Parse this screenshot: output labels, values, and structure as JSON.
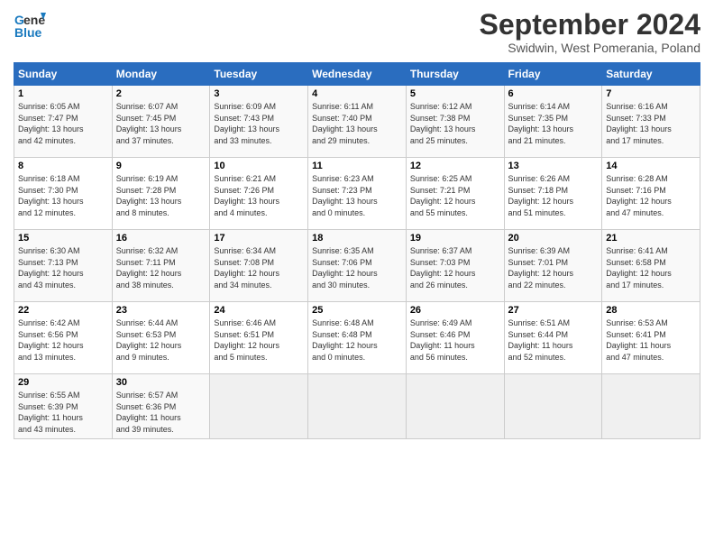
{
  "header": {
    "logo_line1": "General",
    "logo_line2": "Blue",
    "month_title": "September 2024",
    "subtitle": "Swidwin, West Pomerania, Poland"
  },
  "weekdays": [
    "Sunday",
    "Monday",
    "Tuesday",
    "Wednesday",
    "Thursday",
    "Friday",
    "Saturday"
  ],
  "weeks": [
    [
      {
        "day": "1",
        "detail": "Sunrise: 6:05 AM\nSunset: 7:47 PM\nDaylight: 13 hours\nand 42 minutes."
      },
      {
        "day": "2",
        "detail": "Sunrise: 6:07 AM\nSunset: 7:45 PM\nDaylight: 13 hours\nand 37 minutes."
      },
      {
        "day": "3",
        "detail": "Sunrise: 6:09 AM\nSunset: 7:43 PM\nDaylight: 13 hours\nand 33 minutes."
      },
      {
        "day": "4",
        "detail": "Sunrise: 6:11 AM\nSunset: 7:40 PM\nDaylight: 13 hours\nand 29 minutes."
      },
      {
        "day": "5",
        "detail": "Sunrise: 6:12 AM\nSunset: 7:38 PM\nDaylight: 13 hours\nand 25 minutes."
      },
      {
        "day": "6",
        "detail": "Sunrise: 6:14 AM\nSunset: 7:35 PM\nDaylight: 13 hours\nand 21 minutes."
      },
      {
        "day": "7",
        "detail": "Sunrise: 6:16 AM\nSunset: 7:33 PM\nDaylight: 13 hours\nand 17 minutes."
      }
    ],
    [
      {
        "day": "8",
        "detail": "Sunrise: 6:18 AM\nSunset: 7:30 PM\nDaylight: 13 hours\nand 12 minutes."
      },
      {
        "day": "9",
        "detail": "Sunrise: 6:19 AM\nSunset: 7:28 PM\nDaylight: 13 hours\nand 8 minutes."
      },
      {
        "day": "10",
        "detail": "Sunrise: 6:21 AM\nSunset: 7:26 PM\nDaylight: 13 hours\nand 4 minutes."
      },
      {
        "day": "11",
        "detail": "Sunrise: 6:23 AM\nSunset: 7:23 PM\nDaylight: 13 hours\nand 0 minutes."
      },
      {
        "day": "12",
        "detail": "Sunrise: 6:25 AM\nSunset: 7:21 PM\nDaylight: 12 hours\nand 55 minutes."
      },
      {
        "day": "13",
        "detail": "Sunrise: 6:26 AM\nSunset: 7:18 PM\nDaylight: 12 hours\nand 51 minutes."
      },
      {
        "day": "14",
        "detail": "Sunrise: 6:28 AM\nSunset: 7:16 PM\nDaylight: 12 hours\nand 47 minutes."
      }
    ],
    [
      {
        "day": "15",
        "detail": "Sunrise: 6:30 AM\nSunset: 7:13 PM\nDaylight: 12 hours\nand 43 minutes."
      },
      {
        "day": "16",
        "detail": "Sunrise: 6:32 AM\nSunset: 7:11 PM\nDaylight: 12 hours\nand 38 minutes."
      },
      {
        "day": "17",
        "detail": "Sunrise: 6:34 AM\nSunset: 7:08 PM\nDaylight: 12 hours\nand 34 minutes."
      },
      {
        "day": "18",
        "detail": "Sunrise: 6:35 AM\nSunset: 7:06 PM\nDaylight: 12 hours\nand 30 minutes."
      },
      {
        "day": "19",
        "detail": "Sunrise: 6:37 AM\nSunset: 7:03 PM\nDaylight: 12 hours\nand 26 minutes."
      },
      {
        "day": "20",
        "detail": "Sunrise: 6:39 AM\nSunset: 7:01 PM\nDaylight: 12 hours\nand 22 minutes."
      },
      {
        "day": "21",
        "detail": "Sunrise: 6:41 AM\nSunset: 6:58 PM\nDaylight: 12 hours\nand 17 minutes."
      }
    ],
    [
      {
        "day": "22",
        "detail": "Sunrise: 6:42 AM\nSunset: 6:56 PM\nDaylight: 12 hours\nand 13 minutes."
      },
      {
        "day": "23",
        "detail": "Sunrise: 6:44 AM\nSunset: 6:53 PM\nDaylight: 12 hours\nand 9 minutes."
      },
      {
        "day": "24",
        "detail": "Sunrise: 6:46 AM\nSunset: 6:51 PM\nDaylight: 12 hours\nand 5 minutes."
      },
      {
        "day": "25",
        "detail": "Sunrise: 6:48 AM\nSunset: 6:48 PM\nDaylight: 12 hours\nand 0 minutes."
      },
      {
        "day": "26",
        "detail": "Sunrise: 6:49 AM\nSunset: 6:46 PM\nDaylight: 11 hours\nand 56 minutes."
      },
      {
        "day": "27",
        "detail": "Sunrise: 6:51 AM\nSunset: 6:44 PM\nDaylight: 11 hours\nand 52 minutes."
      },
      {
        "day": "28",
        "detail": "Sunrise: 6:53 AM\nSunset: 6:41 PM\nDaylight: 11 hours\nand 47 minutes."
      }
    ],
    [
      {
        "day": "29",
        "detail": "Sunrise: 6:55 AM\nSunset: 6:39 PM\nDaylight: 11 hours\nand 43 minutes."
      },
      {
        "day": "30",
        "detail": "Sunrise: 6:57 AM\nSunset: 6:36 PM\nDaylight: 11 hours\nand 39 minutes."
      },
      {
        "day": "",
        "detail": ""
      },
      {
        "day": "",
        "detail": ""
      },
      {
        "day": "",
        "detail": ""
      },
      {
        "day": "",
        "detail": ""
      },
      {
        "day": "",
        "detail": ""
      }
    ]
  ]
}
